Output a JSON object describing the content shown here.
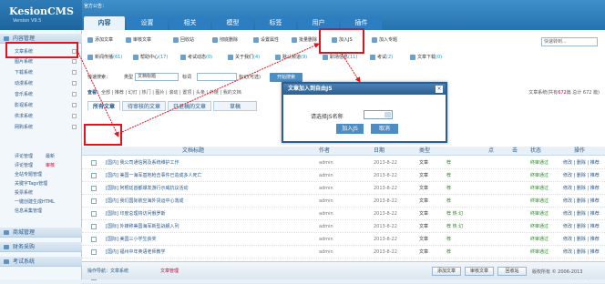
{
  "app": {
    "name": "KesionCMS",
    "version": "Version V9.5",
    "notice": "官方公告："
  },
  "tabs": [
    "内容",
    "设置",
    "相关",
    "模型",
    "标签",
    "用户",
    "插件"
  ],
  "sidebar": {
    "content_section": "内容管理",
    "items": [
      "文章系统",
      "图片系统",
      "下载系统",
      "动漫系统",
      "音乐系统",
      "影视系统",
      "供求系统",
      "网购系统"
    ],
    "plain_links": [
      "评论管理",
      "最新",
      "评论管理",
      "审核",
      "全站专题管理",
      "关键字Tags管理",
      "投票系统",
      "一键创建生成HTML",
      "信息采集管理"
    ],
    "more": "更多",
    "sections": [
      "商城管理",
      "财务采购",
      "考试系统"
    ]
  },
  "toolbar1": [
    "添加文章",
    "审核文章",
    "回收站",
    "彻底删除",
    "设置属性",
    "批量删除",
    "加入JS",
    "加入专题"
  ],
  "toolbar2": [
    {
      "label": "新闻传播",
      "count": "(61)"
    },
    {
      "label": "帮助中心",
      "count": "(17)"
    },
    {
      "label": "考试动态",
      "count": "(0)"
    },
    {
      "label": "关于我们",
      "count": "(4)"
    },
    {
      "label": "默认频道",
      "count": "(9)"
    },
    {
      "label": "职场信息",
      "count": "(11)"
    },
    {
      "label": "考试",
      "count": "(2)"
    },
    {
      "label": "文章下载",
      "count": "(0)"
    }
  ],
  "search": {
    "placeholder": "快速转到..."
  },
  "quick_search": {
    "label": "快速搜索：",
    "type_label": "类型",
    "type_value": "文档标题",
    "keyword_label": "标词",
    "since_label": "标记(可选)",
    "button": "开始搜索"
  },
  "nav": {
    "prefix": "查看：",
    "links": "全部 | 推荐 | 幻灯 | 热门 | 图片 | 滚动 | 置顶 | 头条 | 外链 | 我的文档",
    "count_label": "文章系统(共有",
    "count": "672",
    "count_suffix": "篇 总计 672 篇)"
  },
  "subtabs": [
    "所有文章",
    "待审核的文章",
    "已退稿的文章",
    "草稿"
  ],
  "table": {
    "headers": [
      "文档标题",
      "作者",
      "日期",
      "类型",
      "点",
      "击",
      "状态",
      "操作"
    ],
    "rows": [
      {
        "title": "[国内] 我公司通信网及系统维护工作",
        "author": "admin",
        "date": "2013-8-22",
        "type": "文章",
        "flags": "荐",
        "status": "终审通过",
        "ops": "修改 | 删除 | 推荐"
      },
      {
        "title": "[国内] 美国一海军基地枪击事件已造成多人死亡",
        "author": "admin",
        "date": "2013-8-22",
        "type": "文章",
        "flags": "荐",
        "status": "终审通过",
        "ops": "修改 | 删除 | 推荐"
      },
      {
        "title": "[国际] 阿根廷首都爆发游行示威抗议活动",
        "author": "admin",
        "date": "2013-8-22",
        "type": "文章",
        "flags": "荐",
        "status": "终审通过",
        "ops": "修改 | 删除 | 推荐"
      },
      {
        "title": "[国内] 我们国际航空海外货运中心落成",
        "author": "admin",
        "date": "2013-8-22",
        "type": "文章",
        "flags": "荐",
        "status": "终审通过",
        "ops": "修改 | 删除 | 推荐"
      },
      {
        "title": "[国际] 印度总理将访问俄罗斯",
        "author": "admin",
        "date": "2013-8-22",
        "type": "文章",
        "flags": "荐 热 幻",
        "status": "终审通过",
        "ops": "修改 | 删除 | 推荐"
      },
      {
        "title": "[国际] 外媒称美国海军新型战舰入列",
        "author": "admin",
        "date": "2013-8-22",
        "type": "文章",
        "flags": "荐 热 幻",
        "status": "终审通过",
        "ops": "修改 | 删除 | 推荐"
      },
      {
        "title": "[国际] 美国三小学生获奖",
        "author": "admin",
        "date": "2013-8-22",
        "type": "文章",
        "flags": "荐",
        "status": "终审通过",
        "ops": "修改 | 删除 | 推荐"
      },
      {
        "title": "[国内] 福州中年英语老师教学",
        "author": "admin",
        "date": "2013-8-22",
        "type": "文章",
        "flags": "荐",
        "status": "终审通过",
        "ops": "修改 | 删除 | 推荐"
      },
      {
        "title": "[国内] 厦门动作新疆科技馆开馆",
        "author": "admin",
        "date": "2013-8-22",
        "type": "文章",
        "flags": "荐",
        "status": "终审通过",
        "ops": "修改 | 删除 | 推荐"
      },
      {
        "title": "[国内] 苏联攻占匈牙利出征",
        "author": "admin",
        "date": "2013-8-22",
        "type": "文章",
        "flags": "荐",
        "status": "终审通过",
        "ops": "修改 | 删除 | 推荐"
      }
    ]
  },
  "bottom": {
    "label": "操作导航：文章系统",
    "link": "文章管理",
    "buttons": [
      "添加文章",
      "审核文章",
      "回收站"
    ],
    "copyright": "版权所有 © 2006-2013"
  },
  "dialog": {
    "title": "文章加入到自由JS",
    "label": "请选择JS名称",
    "buttons": [
      "加入JS",
      "取消"
    ]
  },
  "colors": {
    "header": "#2672ae",
    "highlight": "#e0141e",
    "sidebar": "#f2f7fb"
  }
}
